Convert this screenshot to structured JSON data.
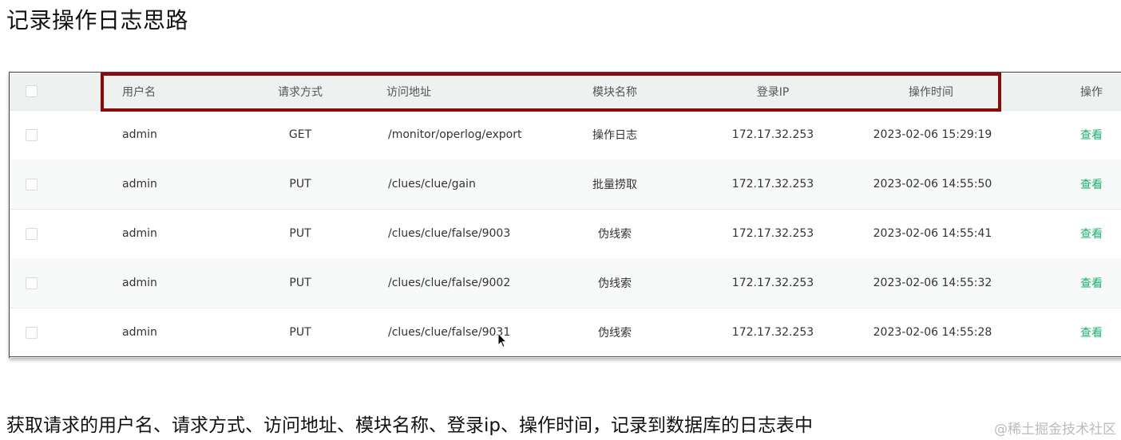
{
  "page": {
    "title": "记录操作日志思路",
    "description": "获取请求的用户名、请求方式、访问地址、模块名称、登录ip、操作时间，记录到数据库的日志表中",
    "watermark": "@稀土掘金技术社区"
  },
  "table": {
    "headers": {
      "username": "用户名",
      "method": "请求方式",
      "url": "访问地址",
      "module": "模块名称",
      "ip": "登录IP",
      "time": "操作时间",
      "action": "操作"
    },
    "rows": [
      {
        "username": "admin",
        "method": "GET",
        "url": "/monitor/operlog/export",
        "module": "操作日志",
        "ip": "172.17.32.253",
        "time": "2023-02-06 15:29:19",
        "action": "查看"
      },
      {
        "username": "admin",
        "method": "PUT",
        "url": "/clues/clue/gain",
        "module": "批量捞取",
        "ip": "172.17.32.253",
        "time": "2023-02-06 14:55:50",
        "action": "查看"
      },
      {
        "username": "admin",
        "method": "PUT",
        "url": "/clues/clue/false/9003",
        "module": "伪线索",
        "ip": "172.17.32.253",
        "time": "2023-02-06 14:55:41",
        "action": "查看"
      },
      {
        "username": "admin",
        "method": "PUT",
        "url": "/clues/clue/false/9002",
        "module": "伪线索",
        "ip": "172.17.32.253",
        "time": "2023-02-06 14:55:32",
        "action": "查看"
      },
      {
        "username": "admin",
        "method": "PUT",
        "url": "/clues/clue/false/9031",
        "module": "伪线索",
        "ip": "172.17.32.253",
        "time": "2023-02-06 14:55:28",
        "action": "查看"
      }
    ]
  },
  "colors": {
    "highlight_border": "#8b0a0a",
    "link": "#19b36b",
    "header_bg": "#edf2f0"
  }
}
